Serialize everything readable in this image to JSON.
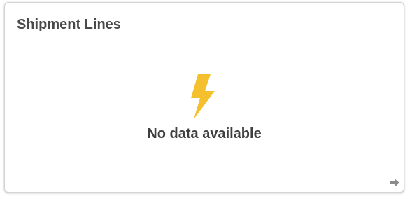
{
  "card": {
    "title": "Shipment Lines",
    "empty_message": "No data available",
    "empty_icon": "lightning-bolt-icon",
    "nav_icon": "arrow-right-icon"
  },
  "colors": {
    "title_text": "#4a4a4a",
    "message_text": "#3f3f3f",
    "bolt_fill": "#f5c02e",
    "arrow_fill": "#8a8a8a",
    "card_border": "#d4d4d4"
  }
}
